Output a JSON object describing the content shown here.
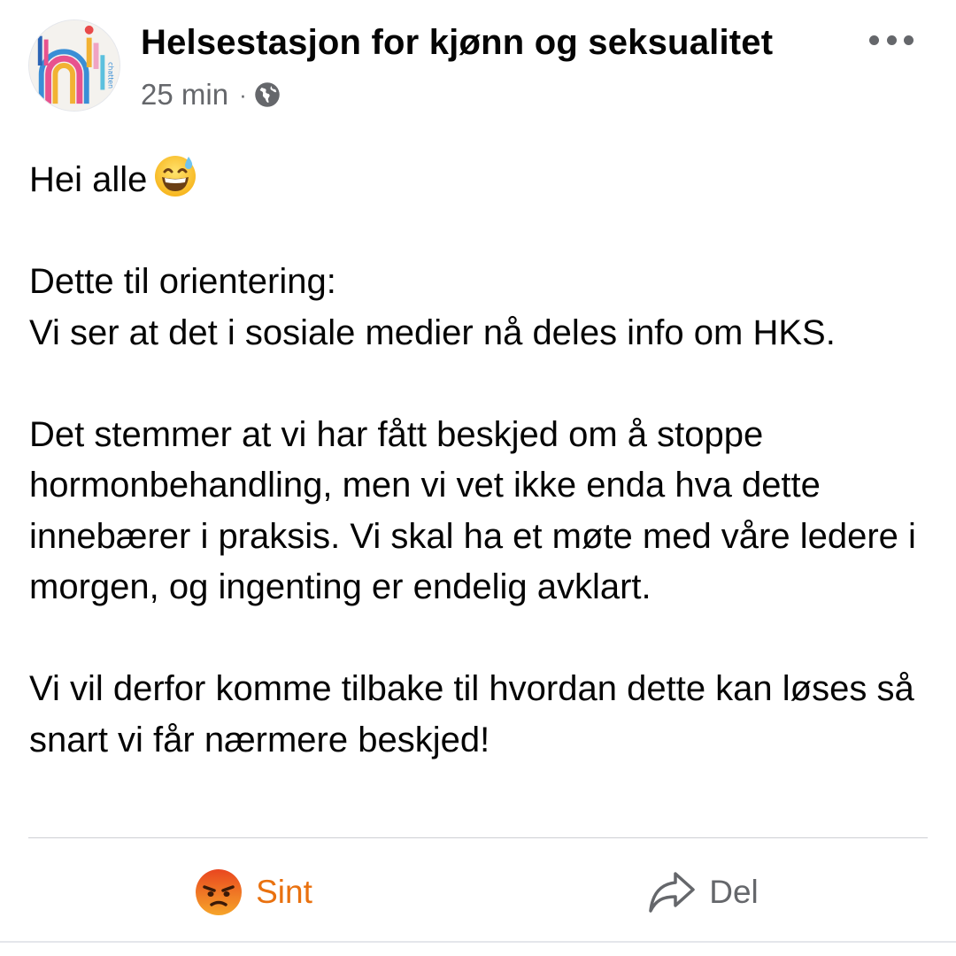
{
  "post": {
    "page_name": "Helsestasjon for kjønn og seksualitet",
    "time": "25 min",
    "separator": "·",
    "audience_icon": "globe-icon",
    "more_icon": "more-options-icon",
    "avatar_logo_text": "hks",
    "paragraphs": [
      "Hei alle",
      "Dette til orientering:",
      "Vi ser at det i sosiale medier nå deles info om HKS.",
      "Det stemmer at vi har fått beskjed om å stoppe hormonbehandling, men vi vet ikke enda hva dette innebærer i praksis. Vi skal ha et møte med våre ledere i morgen, og ingenting er endelig avklart.",
      "Vi vil derfor komme tilbake til hvordan dette kan løses så snart vi får nærmere beskjed!"
    ],
    "greeting_emoji": "grinning-sweat-emoji"
  },
  "actions": {
    "reaction_label": "Sint",
    "reaction_icon": "angry-face-icon",
    "reaction_color": "#e9710f",
    "share_label": "Del",
    "share_icon": "share-arrow-icon"
  }
}
